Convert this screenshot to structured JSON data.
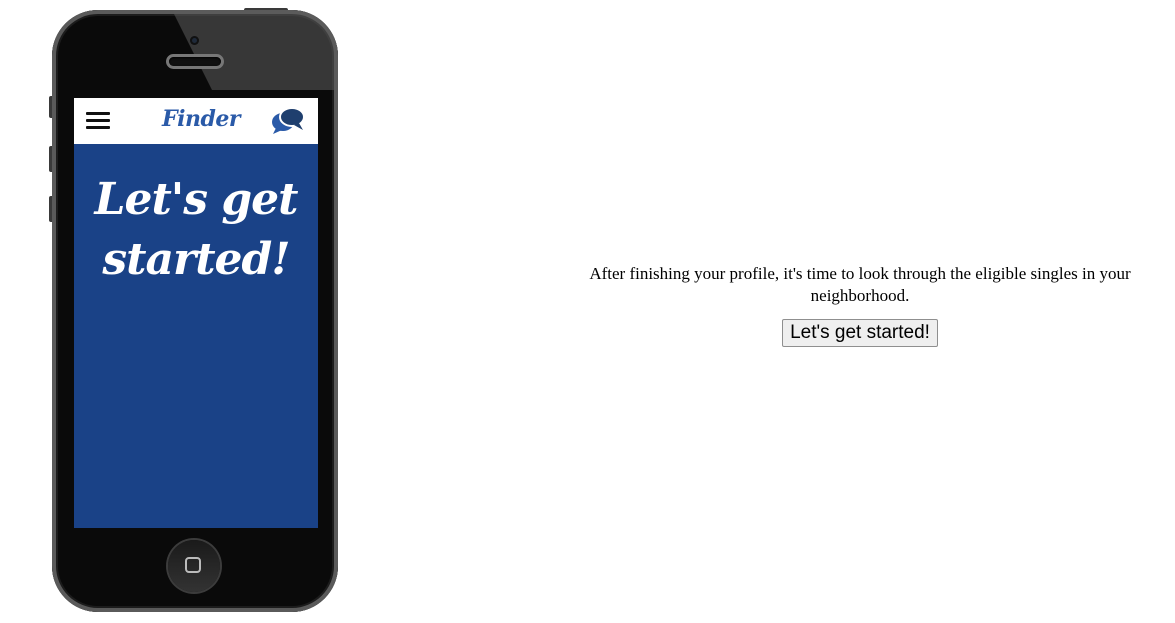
{
  "phone": {
    "app": {
      "logo_text": "Finder",
      "menu_icon": "hamburger-menu-icon",
      "chat_icon": "chat-bubbles-icon",
      "hero_line1": "Let's get",
      "hero_line2": "started!"
    },
    "colors": {
      "screen_background": "#1a4287",
      "logo": "#2a5aa8",
      "app_bar": "#ffffff"
    }
  },
  "main": {
    "description": "After finishing your profile, it's time to look through the eligible singles in your neighborhood.",
    "cta_label": "Let's get started!"
  }
}
